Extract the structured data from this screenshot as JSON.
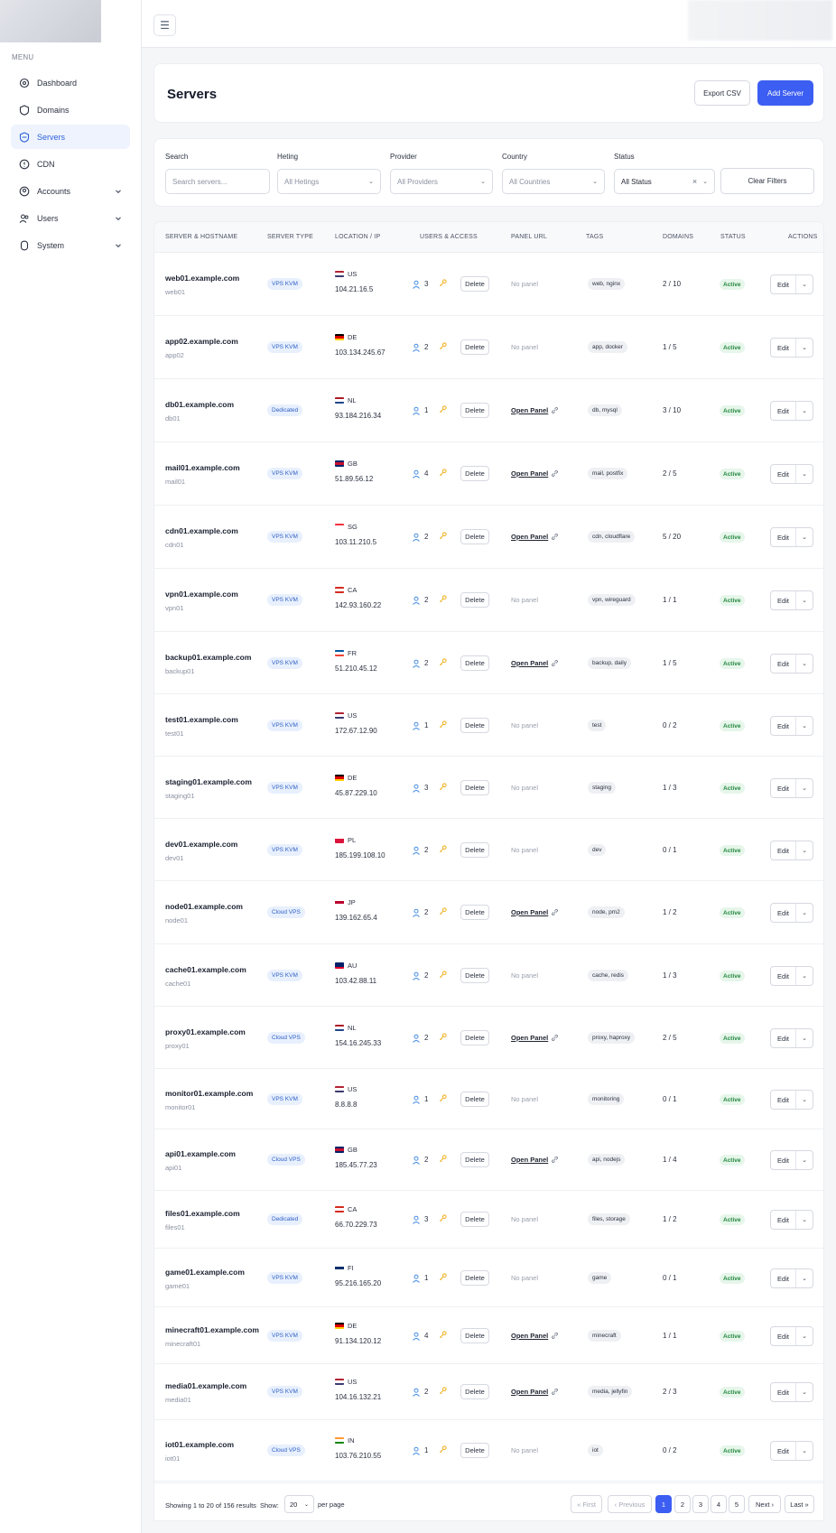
{
  "sidebar": {
    "menu_title": "MENU",
    "items": [
      {
        "label": "Dashboard",
        "icon": "dashboard-icon",
        "active": false,
        "chevron": false
      },
      {
        "label": "Domains",
        "icon": "domains-icon",
        "active": false,
        "chevron": false
      },
      {
        "label": "Servers",
        "icon": "servers-icon",
        "active": true,
        "chevron": false
      },
      {
        "label": "CDN",
        "icon": "cdn-icon",
        "active": false,
        "chevron": false
      },
      {
        "label": "Accounts",
        "icon": "accounts-icon",
        "active": false,
        "chevron": true
      },
      {
        "label": "Users",
        "icon": "users-icon",
        "active": false,
        "chevron": true
      },
      {
        "label": "System",
        "icon": "system-icon",
        "active": false,
        "chevron": true
      }
    ]
  },
  "topbar": {
    "menu_icon": "☰"
  },
  "header": {
    "title": "Servers",
    "export_label": "Export CSV",
    "add_label": "Add Server"
  },
  "filters": {
    "search_label": "Search",
    "search_placeholder": "Search servers...",
    "heting_label": "Heting",
    "heting_value": "All Hetings",
    "provider_label": "Provider",
    "provider_value": "All Providers",
    "country_label": "Country",
    "country_value": "All Countries",
    "status_label": "Status",
    "status_value": "All Status",
    "clear_label": "Clear Filters"
  },
  "table": {
    "headers": {
      "host": "SERVER & HOSTNAME",
      "type": "SERVER TYPE",
      "location": "LOCATION / IP",
      "users": "USERS & ACCESS",
      "panel": "PANEL URL",
      "tags": "TAGS",
      "domains": "DOMAINS",
      "status": "STATUS",
      "actions": "ACTIONS"
    },
    "delete_label": "Delete",
    "edit_label": "Edit",
    "no_panel_label": "No panel",
    "open_panel_label": "Open Panel",
    "rows": [
      {
        "host": "web01.example.com",
        "short": "web01",
        "type": "VPS KVM",
        "cc": "US",
        "ip": "104.21.16.5",
        "users": "3",
        "panel": false,
        "tags": "web, nginx",
        "domains": "2 / 10",
        "status": "Active"
      },
      {
        "host": "app02.example.com",
        "short": "app02",
        "type": "VPS KVM",
        "cc": "DE",
        "ip": "103.134.245.67",
        "users": "2",
        "panel": false,
        "tags": "app, docker",
        "domains": "1 / 5",
        "status": "Active"
      },
      {
        "host": "db01.example.com",
        "short": "db01",
        "type": "Dedicated",
        "cc": "NL",
        "ip": "93.184.216.34",
        "users": "1",
        "panel": true,
        "tags": "db, mysql",
        "domains": "3 / 10",
        "status": "Active"
      },
      {
        "host": "mail01.example.com",
        "short": "mail01",
        "type": "VPS KVM",
        "cc": "GB",
        "ip": "51.89.56.12",
        "users": "4",
        "panel": true,
        "tags": "mail, postfix",
        "domains": "2 / 5",
        "status": "Active"
      },
      {
        "host": "cdn01.example.com",
        "short": "cdn01",
        "type": "VPS KVM",
        "cc": "SG",
        "ip": "103.11.210.5",
        "users": "2",
        "panel": true,
        "tags": "cdn, cloudflare",
        "domains": "5 / 20",
        "status": "Active"
      },
      {
        "host": "vpn01.example.com",
        "short": "vpn01",
        "type": "VPS KVM",
        "cc": "CA",
        "ip": "142.93.160.22",
        "users": "2",
        "panel": false,
        "tags": "vpn, wireguard",
        "domains": "1 / 1",
        "status": "Active"
      },
      {
        "host": "backup01.example.com",
        "short": "backup01",
        "type": "VPS KVM",
        "cc": "FR",
        "ip": "51.210.45.12",
        "users": "2",
        "panel": true,
        "tags": "backup, daily",
        "domains": "1 / 5",
        "status": "Active"
      },
      {
        "host": "test01.example.com",
        "short": "test01",
        "type": "VPS KVM",
        "cc": "US",
        "ip": "172.67.12.90",
        "users": "1",
        "panel": false,
        "tags": "test",
        "domains": "0 / 2",
        "status": "Active"
      },
      {
        "host": "staging01.example.com",
        "short": "staging01",
        "type": "VPS KVM",
        "cc": "DE",
        "ip": "45.87.229.10",
        "users": "3",
        "panel": false,
        "tags": "staging",
        "domains": "1 / 3",
        "status": "Active"
      },
      {
        "host": "dev01.example.com",
        "short": "dev01",
        "type": "VPS KVM",
        "cc": "PL",
        "ip": "185.199.108.10",
        "users": "2",
        "panel": false,
        "tags": "dev",
        "domains": "0 / 1",
        "status": "Active"
      },
      {
        "host": "node01.example.com",
        "short": "node01",
        "type": "Cloud VPS",
        "cc": "JP",
        "ip": "139.162.65.4",
        "users": "2",
        "panel": true,
        "tags": "node, pm2",
        "domains": "1 / 2",
        "status": "Active"
      },
      {
        "host": "cache01.example.com",
        "short": "cache01",
        "type": "VPS KVM",
        "cc": "AU",
        "ip": "103.42.88.11",
        "users": "2",
        "panel": false,
        "tags": "cache, redis",
        "domains": "1 / 3",
        "status": "Active"
      },
      {
        "host": "proxy01.example.com",
        "short": "proxy01",
        "type": "Cloud VPS",
        "cc": "NL",
        "ip": "154.16.245.33",
        "users": "2",
        "panel": true,
        "tags": "proxy, haproxy",
        "domains": "2 / 5",
        "status": "Active"
      },
      {
        "host": "monitor01.example.com",
        "short": "monitor01",
        "type": "VPS KVM",
        "cc": "US",
        "ip": "8.8.8.8",
        "users": "1",
        "panel": false,
        "tags": "monitoring",
        "domains": "0 / 1",
        "status": "Active"
      },
      {
        "host": "api01.example.com",
        "short": "api01",
        "type": "Cloud VPS",
        "cc": "GB",
        "ip": "185.45.77.23",
        "users": "2",
        "panel": true,
        "tags": "api, nodejs",
        "domains": "1 / 4",
        "status": "Active"
      },
      {
        "host": "files01.example.com",
        "short": "files01",
        "type": "Dedicated",
        "cc": "CA",
        "ip": "66.70.229.73",
        "users": "3",
        "panel": false,
        "tags": "files, storage",
        "domains": "1 / 2",
        "status": "Active"
      },
      {
        "host": "game01.example.com",
        "short": "game01",
        "type": "VPS KVM",
        "cc": "FI",
        "ip": "95.216.165.20",
        "users": "1",
        "panel": false,
        "tags": "game",
        "domains": "0 / 1",
        "status": "Active"
      },
      {
        "host": "minecraft01.example.com",
        "short": "minecraft01",
        "type": "VPS KVM",
        "cc": "DE",
        "ip": "91.134.120.12",
        "users": "4",
        "panel": true,
        "tags": "minecraft",
        "domains": "1 / 1",
        "status": "Active"
      },
      {
        "host": "media01.example.com",
        "short": "media01",
        "type": "VPS KVM",
        "cc": "US",
        "ip": "104.16.132.21",
        "users": "2",
        "panel": true,
        "tags": "media, jellyfin",
        "domains": "2 / 3",
        "status": "Active"
      },
      {
        "host": "iot01.example.com",
        "short": "iot01",
        "type": "Cloud VPS",
        "cc": "IN",
        "ip": "103.76.210.55",
        "users": "1",
        "panel": false,
        "tags": "iot",
        "domains": "0 / 2",
        "status": "Active"
      }
    ]
  },
  "flag_colors": {
    "US": [
      "#b22234",
      "#ffffff",
      "#3c3b6e"
    ],
    "DE": [
      "#000000",
      "#dd0000",
      "#ffce00"
    ],
    "NL": [
      "#ae1c28",
      "#ffffff",
      "#21468b"
    ],
    "GB": [
      "#012169",
      "#c8102e",
      "#012169"
    ],
    "SG": [
      "#ef3340",
      "#ffffff",
      "#ffffff"
    ],
    "CA": [
      "#d52b1e",
      "#ffffff",
      "#d52b1e"
    ],
    "FR": [
      "#0055a4",
      "#ffffff",
      "#ef4135"
    ],
    "PL": [
      "#ffffff",
      "#dc143c",
      "#dc143c"
    ],
    "JP": [
      "#ffffff",
      "#bc002d",
      "#ffffff"
    ],
    "AU": [
      "#012169",
      "#012169",
      "#e4002b"
    ],
    "FI": [
      "#ffffff",
      "#002f6c",
      "#ffffff"
    ],
    "IN": [
      "#ff9933",
      "#ffffff",
      "#138808"
    ]
  },
  "footer": {
    "showing": "Showing 1 to 20 of 156 results",
    "show_label": "Show:",
    "per_page_value": "20",
    "per_page_label": "per page",
    "first": "« First",
    "previous": "‹ Previous",
    "pages": [
      "1",
      "2",
      "3",
      "4",
      "5"
    ],
    "next": "Next ›",
    "last": "Last »"
  },
  "colors": {
    "accent": "#3c5ef2",
    "active_status": "#23873e",
    "key": "#f0b429",
    "user": "#4a90e2"
  }
}
